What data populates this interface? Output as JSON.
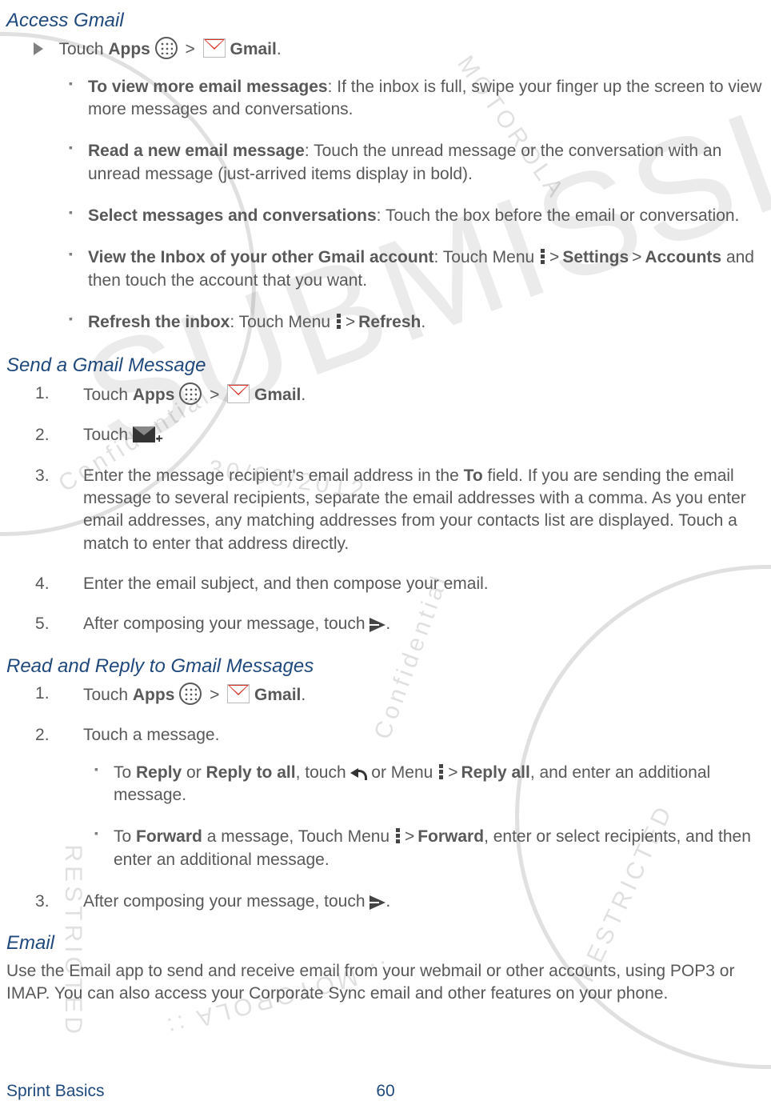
{
  "s1": {
    "title": "Access Gmail",
    "lead_pre": "Touch ",
    "lead_apps": "Apps",
    "lead_gmail": "Gmail",
    "b1_t": "To view more email messages",
    "b1_r": ": If the inbox is full, swipe your finger up the screen to view more messages and conversations.",
    "b2_t": "Read a new email message",
    "b2_r": ": Touch the unread message or the conversation with an unread message (just-arrived items display in bold).",
    "b3_t": "Select messages and conversations",
    "b3_r": ": Touch the box before the email or conversation.",
    "b4_t": "View the Inbox of your other Gmail account",
    "b4_mid1": ": Touch Menu ",
    "b4_settings": "Settings",
    "b4_accounts": "Accounts",
    "b4_tail": " and then touch the account that you want.",
    "b5_t": "Refresh the inbox",
    "b5_mid": ": Touch Menu ",
    "b5_refresh": "Refresh"
  },
  "s2": {
    "title": "Send a Gmail Message",
    "step1_pre": "Touch ",
    "step1_apps": "Apps",
    "step1_gmail": "Gmail",
    "step2": "Touch ",
    "step3a": "Enter the message recipient's email address in the ",
    "step3to": "To",
    "step3b": " field. If you are sending the email message to several recipients, separate the email addresses with a comma. As you enter email addresses, any matching addresses from your contacts list are displayed. Touch a match to enter that address directly.",
    "step4": "Enter the email subject, and then compose your email.",
    "step5": "After composing your message, touch "
  },
  "s3": {
    "title": "Read and Reply to Gmail Messages",
    "step1_pre": "Touch ",
    "step1_apps": "Apps",
    "step1_gmail": "Gmail",
    "step2": "Touch a message.",
    "sb1_a": "To ",
    "sb1_reply": "Reply",
    "sb1_or": " or ",
    "sb1_replyall": "Reply to all",
    "sb1_b": ", touch ",
    "sb1_c": " or Menu ",
    "sb1_replyall2": "Reply all",
    "sb1_d": ", and enter an additional message.",
    "sb2_a": "To ",
    "sb2_fwd": "Forward",
    "sb2_b": " a message, Touch Menu ",
    "sb2_fwd2": "Forward",
    "sb2_c": ", enter or select recipients, and then enter an additional message.",
    "step3": "After composing your message, touch "
  },
  "s4": {
    "title": "Email",
    "body": "Use the Email app to send and receive email from your webmail or other accounts, using POP3 or IMAP. You can also access your Corporate Sync email and other features on your phone."
  },
  "footer": {
    "left": "Sprint Basics",
    "page": "60"
  },
  "sym": {
    "gt": ">",
    "dot": "."
  }
}
